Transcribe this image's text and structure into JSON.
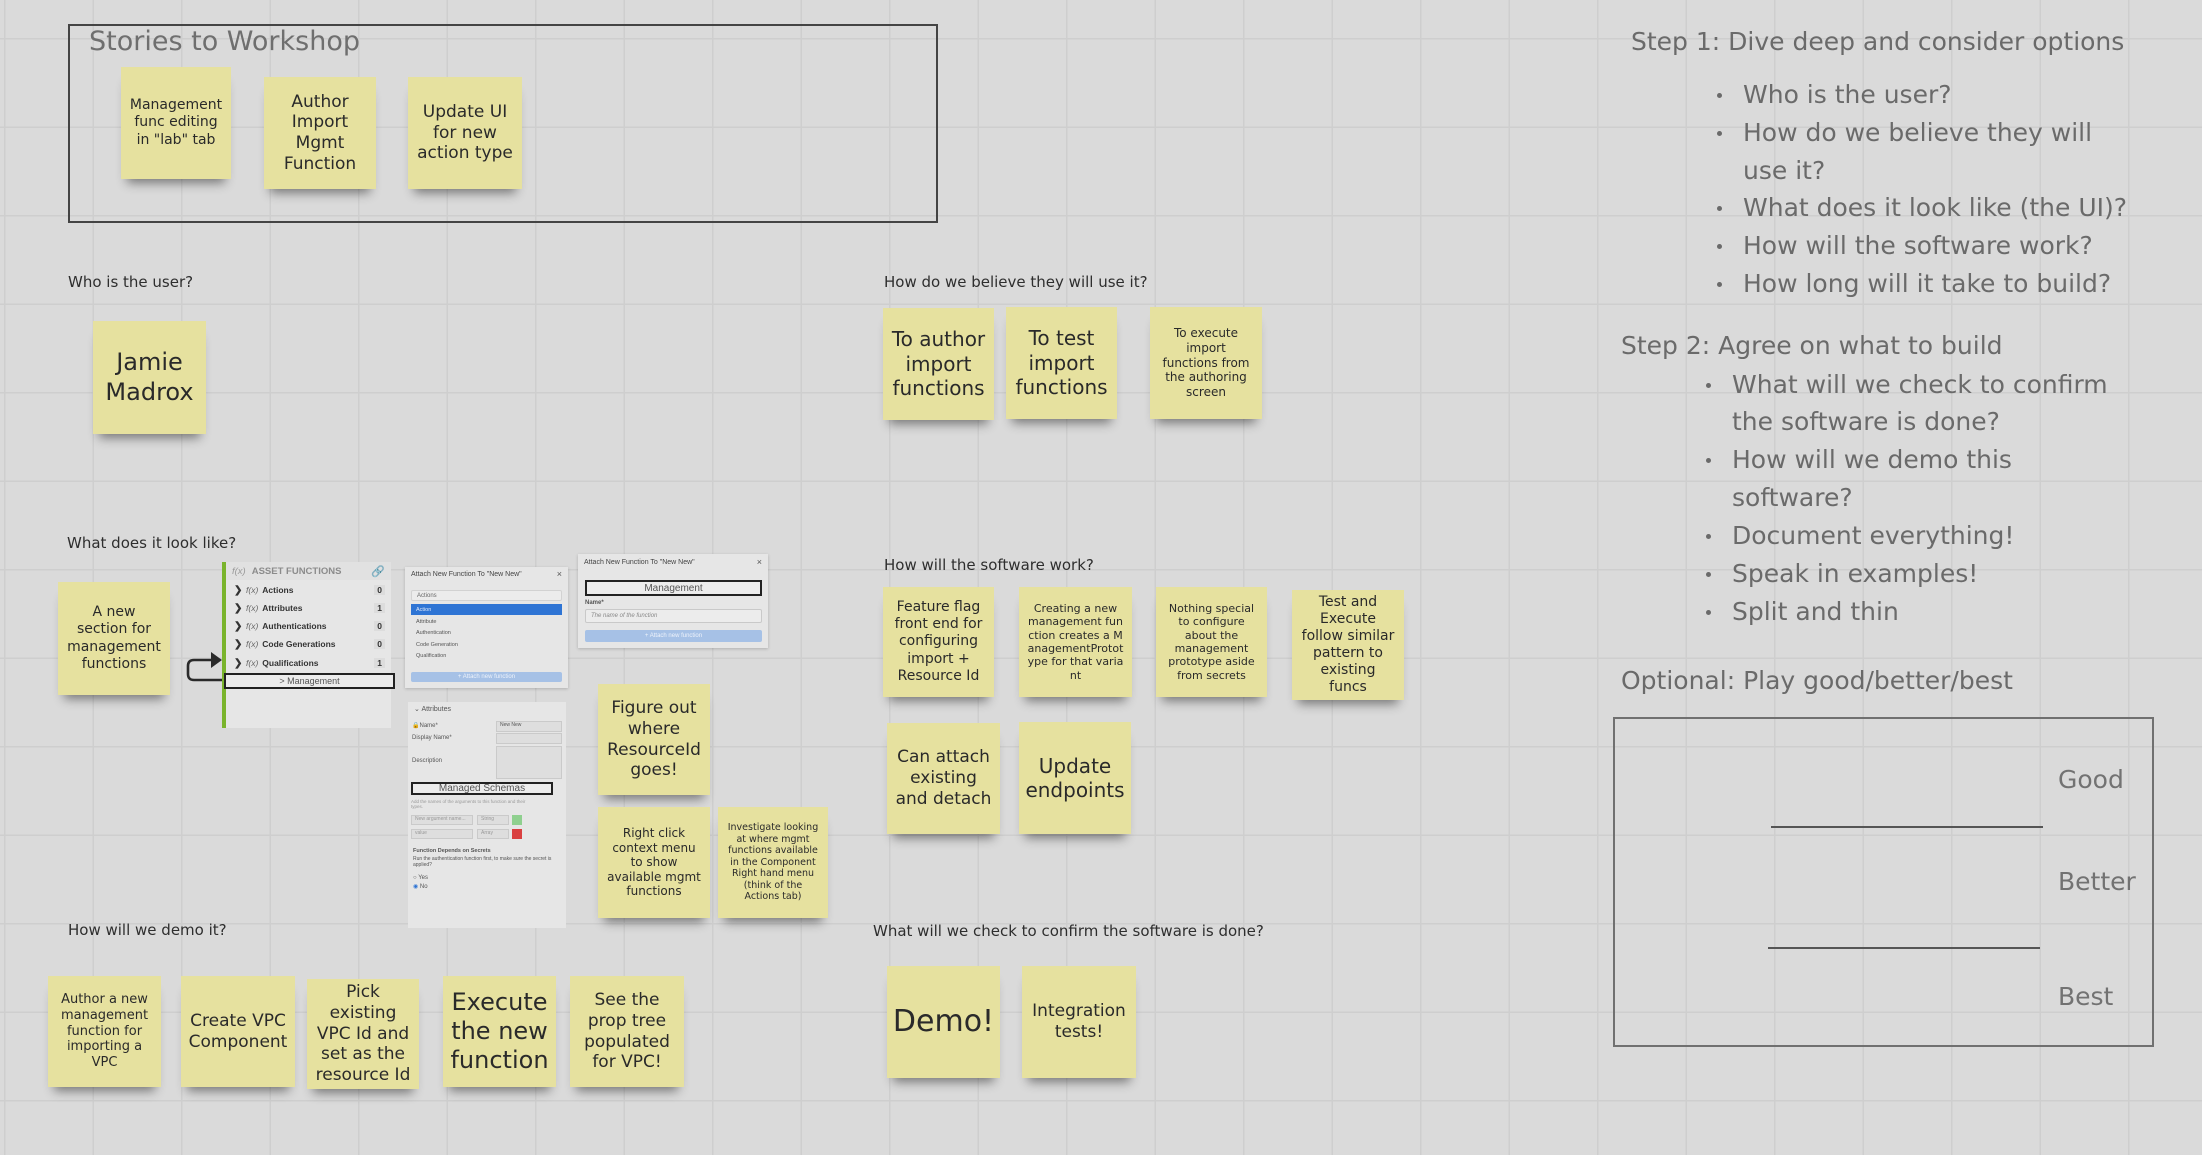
{
  "stories_frame": {
    "title": "Stories to Workshop",
    "stickies": [
      "Management func editing in \"lab\" tab",
      "Author Import Mgmt Function",
      "Update UI for new action type"
    ]
  },
  "sections": {
    "who": {
      "label": "Who is the user?",
      "stickies": [
        "Jamie Madrox"
      ]
    },
    "how_use": {
      "label": "How do we believe they will use it?",
      "stickies": [
        "To author import functions",
        "To test import functions",
        "To execute import functions from the authoring screen"
      ]
    },
    "look": {
      "label": "What does it look like?",
      "stickies": [
        "A new section for management functions",
        "Figure out where ResourceId goes!",
        "Right click context menu to show available mgmt functions",
        "Investigate looking at where mgmt functions available in the Component Right hand menu (think of the Actions tab)"
      ]
    },
    "work": {
      "label": "How will the software work?",
      "stickies": [
        "Feature flag front end for configuring import + Resource Id",
        "Creating a new management function creates a ManagementPrototype for that variant",
        "Nothing special to configure about the management prototype aside from secrets",
        "Test and Execute follow similar pattern to existing funcs",
        "Can attach existing and detach",
        "Update endpoints"
      ]
    },
    "demo": {
      "label": "How will we demo it?",
      "stickies": [
        "Author a new management function for importing a VPC",
        "Create VPC Component",
        "Pick existing VPC Id and set as the resource Id",
        "Execute the new function",
        "See the prop tree populated for VPC!"
      ]
    },
    "done": {
      "label": "What will we check to confirm the software is done?",
      "stickies": [
        "Demo!",
        "Integration tests!"
      ]
    }
  },
  "mockups": {
    "asset_panel": {
      "title": "ASSET FUNCTIONS",
      "fx": "f(x)",
      "rows": [
        {
          "label": "Actions",
          "count": "0"
        },
        {
          "label": "Attributes",
          "count": "1"
        },
        {
          "label": "Authentications",
          "count": "0"
        },
        {
          "label": "Code Generations",
          "count": "0"
        },
        {
          "label": "Qualifications",
          "count": "1"
        }
      ],
      "new_section": "> Management"
    },
    "attach_dialog_1": {
      "title": "Attach New Function To \"New New\"",
      "close": "×",
      "select_value": "Actions",
      "options": [
        "Action",
        "Attribute",
        "Authentication",
        "Code Generation",
        "Qualification"
      ],
      "selected_option": "Action",
      "button": "+ Attach new function"
    },
    "attach_dialog_2": {
      "title": "Attach New Function To \"New New\"",
      "close": "×",
      "kind": "Management",
      "name_label": "Name*",
      "name_placeholder": "The name of the function",
      "button": "+ Attach new function"
    },
    "attributes_panel": {
      "header": "Attributes",
      "name_label": "Name*",
      "name_value": "New New",
      "display_name_label": "Display Name*",
      "description_label": "Description",
      "managed_schemas": "Managed Schemas",
      "schemas_help": "Add the names of the arguments to this function and their types.",
      "arg_placeholder": "New argument name...",
      "arg_type": "String",
      "value_field": "value",
      "value_type": "Array",
      "secrets_title": "Function Depends on Secrets",
      "secrets_help": "Run the authentication function first, to make sure the secret is applied?",
      "radio_yes": "Yes",
      "radio_no": "No",
      "radio_selected": "No"
    }
  },
  "sidebar_notes": {
    "step1": {
      "title": "Step 1: Dive deep and consider options",
      "bullets": [
        "Who is the user?",
        "How do we believe they will",
        "use it?",
        "What does it look like (the UI)?",
        "How will the software work?",
        "How long will it take to build?"
      ]
    },
    "step2": {
      "title": "Step 2: Agree on what to build",
      "bullets": [
        "What will we check to confirm",
        "the software is done?",
        "How will we demo this",
        "software?",
        "Document everything!",
        "Speak in examples!",
        "Split and thin"
      ]
    },
    "optional": {
      "title": "Optional: Play good/better/best",
      "levels": [
        "Good",
        "Better",
        "Best"
      ]
    }
  },
  "colors": {
    "canvas": "#dadada",
    "sticky": "#e6e19f",
    "accent_green": "#7ab42c",
    "selected_blue": "#2e74d4"
  }
}
